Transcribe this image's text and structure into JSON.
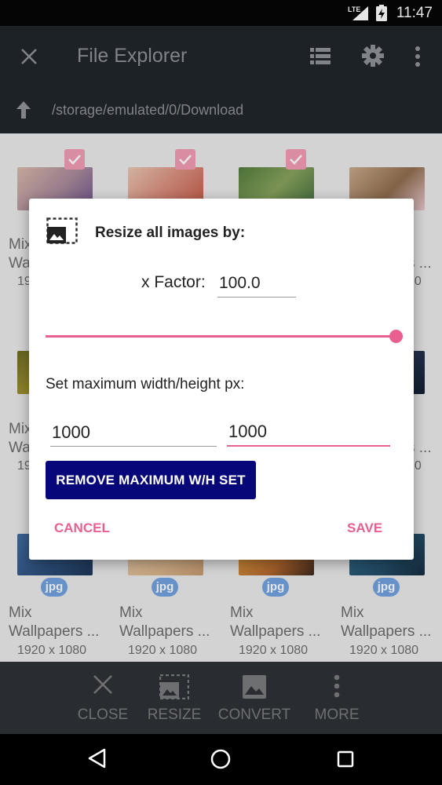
{
  "status_bar": {
    "time": "11:47",
    "network": "LTE"
  },
  "toolbar": {
    "title": "File Explorer"
  },
  "path_bar": {
    "path": "/storage/emulated/0/Download"
  },
  "grid": {
    "rows": [
      [
        {
          "name": "Mix",
          "name2": "Wa",
          "sub": "19",
          "checked": true
        },
        {
          "name": "",
          "name2": "",
          "sub": "",
          "checked": true
        },
        {
          "name": "",
          "name2": "",
          "sub": "",
          "checked": true
        },
        {
          "name": "",
          "name2": "s ...",
          "sub": "80",
          "checked": false
        }
      ],
      [
        {
          "name": "Mix",
          "name2": "Wa",
          "sub": "19"
        },
        {
          "name": "",
          "name2": "",
          "sub": ""
        },
        {
          "name": "",
          "name2": "",
          "sub": ""
        },
        {
          "name": "",
          "name2": "s ...",
          "sub": "80"
        }
      ],
      [
        {
          "badge": "jpg",
          "name": "Mix",
          "name2": "Wallpapers ...",
          "sub": "1920 x 1080"
        },
        {
          "badge": "jpg",
          "name": "Mix",
          "name2": "Wallpapers ...",
          "sub": "1920 x 1080"
        },
        {
          "badge": "jpg",
          "name": "Mix",
          "name2": "Wallpapers ...",
          "sub": "1920 x 1080"
        },
        {
          "badge": "jpg",
          "name": "Mix",
          "name2": "Wallpapers ...",
          "sub": "1920 x 1080"
        }
      ]
    ]
  },
  "dialog": {
    "title": "Resize all images by:",
    "factor_label": "x Factor:",
    "factor_value": "100.0",
    "slider_level_percent": 100,
    "max_label": "Set maximum width/height px:",
    "width_value": "1000",
    "height_value": "1000",
    "remove_button": "REMOVE MAXIMUM W/H SET",
    "cancel": "CANCEL",
    "save": "SAVE"
  },
  "action_bar": {
    "close": "CLOSE",
    "resize": "RESIZE",
    "convert": "CONVERT",
    "more": "MORE"
  },
  "colors": {
    "accent": "#e85f90",
    "primary_button": "#07077a",
    "toolbar": "#1c2126",
    "action_bar": "#2a2d31"
  },
  "icons": [
    "close-icon",
    "list-view-icon",
    "settings-icon",
    "overflow-menu-icon",
    "up-arrow-icon",
    "resize-icon",
    "image-icon",
    "back-nav-icon",
    "home-nav-icon",
    "recents-nav-icon"
  ]
}
